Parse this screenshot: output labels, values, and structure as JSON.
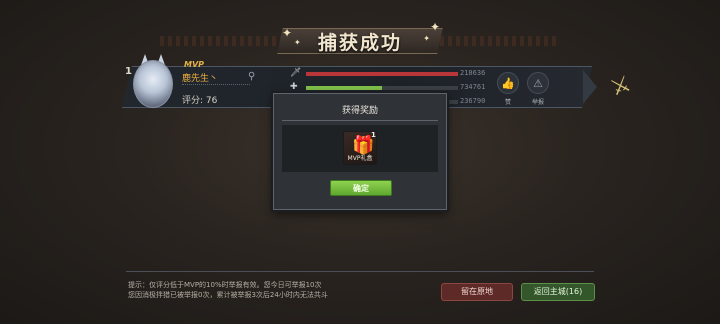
{
  "header": {
    "title": "捕获成功"
  },
  "player": {
    "rank": "1",
    "mvp_label": "MVP",
    "name": "鹿先生丶",
    "score_text": "评分: 76",
    "stats": [
      {
        "icon": "sword-icon",
        "glyph": "🗡",
        "value": "218636",
        "fill": 1.0,
        "color": "#b8353a"
      },
      {
        "icon": "heal-icon",
        "glyph": "✚",
        "value": "734761",
        "fill": 0.5,
        "color": "#7fbf4a"
      },
      {
        "icon": "shield-icon",
        "glyph": "",
        "value": "236790",
        "fill": 0.0,
        "color": "#6c8fd0"
      }
    ],
    "like_label": "赞",
    "report_label": "举报"
  },
  "modal": {
    "title": "获得奖励",
    "reward": {
      "name": "MVP礼盒",
      "count": "1"
    },
    "confirm_label": "确定"
  },
  "footer": {
    "hint_line1": "提示：仅评分低于MVP的10%时举报有效。您今日可举报10次",
    "hint_line2": "您因消极拌猎已被举报0次，累计被举报3次后24小时内无法共斗",
    "stay_label": "留在原地",
    "return_label": "返回主城(16)"
  }
}
